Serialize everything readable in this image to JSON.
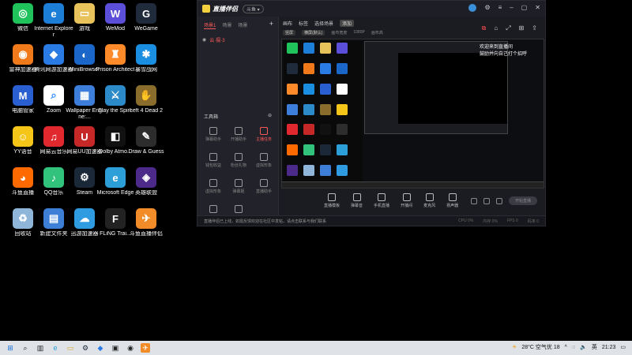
{
  "desktop": {
    "icons": [
      {
        "label": "微信",
        "icon": "wechat-icon",
        "color": "#20c35b",
        "glyph": "◎",
        "col": 0,
        "row": 0
      },
      {
        "label": "Internet Explorer",
        "icon": "ie-icon",
        "color": "#1c7ed6",
        "glyph": "e",
        "col": 1,
        "row": 0
      },
      {
        "label": "游戏",
        "icon": "folder-icon",
        "color": "#e8c25a",
        "glyph": "▭",
        "col": 2,
        "row": 0
      },
      {
        "label": "WeMod",
        "icon": "wemod-icon",
        "color": "#5b4fd9",
        "glyph": "W",
        "col": 3,
        "row": 0
      },
      {
        "label": "WeGame",
        "icon": "wegame-icon",
        "color": "#1f2b3a",
        "glyph": "G",
        "col": 4,
        "row": 0
      },
      {
        "label": "雷神加速器",
        "icon": "leishen-icon",
        "color": "#f07a1a",
        "glyph": "◉",
        "col": 0,
        "row": 1
      },
      {
        "label": "腾讯网游加速器",
        "icon": "tencent-acc-icon",
        "color": "#2a7be4",
        "glyph": "◆",
        "col": 1,
        "row": 1
      },
      {
        "label": "MiniBrowser",
        "icon": "minibrowser-icon",
        "color": "#1a66c9",
        "glyph": "◐",
        "col": 2,
        "row": 1
      },
      {
        "label": "Prison Architect",
        "icon": "prison-architect-icon",
        "color": "#ff8a2a",
        "glyph": "♜",
        "col": 3,
        "row": 1
      },
      {
        "label": "暴雪战网",
        "icon": "battlenet-icon",
        "color": "#1a8ee0",
        "glyph": "✱",
        "col": 4,
        "row": 1
      },
      {
        "label": "电脑管家",
        "icon": "pc-manager-icon",
        "color": "#2a5fd1",
        "glyph": "M",
        "col": 0,
        "row": 2
      },
      {
        "label": "Zoom",
        "icon": "zoom-icon",
        "color": "#ffffff",
        "glyph": "⌕",
        "col": 1,
        "row": 2
      },
      {
        "label": "Wallpaper Engine:...",
        "icon": "wallpaper-engine-icon",
        "color": "#3d7edb",
        "glyph": "▦",
        "col": 2,
        "row": 2
      },
      {
        "label": "Slay the Spire",
        "icon": "slay-the-spire-icon",
        "color": "#2c8ac9",
        "glyph": "⚔",
        "col": 3,
        "row": 2
      },
      {
        "label": "Left 4 Dead 2",
        "icon": "left4dead2-icon",
        "color": "#8a6d2c",
        "glyph": "✋",
        "col": 4,
        "row": 2
      },
      {
        "label": "YY语音",
        "icon": "yy-icon",
        "color": "#f5c518",
        "glyph": "☺",
        "col": 0,
        "row": 3
      },
      {
        "label": "网易云音乐",
        "icon": "netease-music-icon",
        "color": "#e0282e",
        "glyph": "♫",
        "col": 1,
        "row": 3
      },
      {
        "label": "网易UU加速器",
        "icon": "uu-icon",
        "color": "#c62828",
        "glyph": "U",
        "col": 2,
        "row": 3
      },
      {
        "label": "Dolby Atmo...",
        "icon": "dolby-icon",
        "color": "#111111",
        "glyph": "◧",
        "col": 3,
        "row": 3
      },
      {
        "label": "Draw & Guess",
        "icon": "draw-guess-icon",
        "color": "#2d2d2d",
        "glyph": "✎",
        "col": 4,
        "row": 3
      },
      {
        "label": "斗鱼直播",
        "icon": "douyu-icon",
        "color": "#ff6a00",
        "glyph": "◕",
        "col": 0,
        "row": 4
      },
      {
        "label": "QQ音乐",
        "icon": "qqmusic-icon",
        "color": "#31c27c",
        "glyph": "♪",
        "col": 1,
        "row": 4
      },
      {
        "label": "Steam",
        "icon": "steam-icon",
        "color": "#1b2838",
        "glyph": "⚙",
        "col": 2,
        "row": 4
      },
      {
        "label": "Microsoft Edge",
        "icon": "edge-icon",
        "color": "#2c9fd8",
        "glyph": "e",
        "col": 3,
        "row": 4
      },
      {
        "label": "英雄联盟",
        "icon": "lol-icon",
        "color": "#4b2a8a",
        "glyph": "◈",
        "col": 4,
        "row": 4
      },
      {
        "label": "回收站",
        "icon": "recycle-bin-icon",
        "color": "#8fb6d9",
        "glyph": "♻",
        "col": 0,
        "row": 5
      },
      {
        "label": "新建文件夹",
        "icon": "new-folder-icon",
        "color": "#3d7fd6",
        "glyph": "▤",
        "col": 1,
        "row": 5
      },
      {
        "label": "迅游加速器",
        "icon": "xunyou-icon",
        "color": "#2f9be0",
        "glyph": "☁",
        "col": 2,
        "row": 5
      },
      {
        "label": "FLiNG Trai...",
        "icon": "fling-trainer-icon",
        "color": "#222222",
        "glyph": "F",
        "col": 3,
        "row": 5
      },
      {
        "label": "斗鱼直播伴侣",
        "icon": "douyu-companion-icon",
        "color": "#f28c28",
        "glyph": "✈",
        "col": 4,
        "row": 5
      }
    ]
  },
  "app": {
    "title": "直播伴侣",
    "version": "斗鱼 ▾",
    "left_tabs": [
      "场景1",
      "场景",
      "场景"
    ],
    "scene_item": "云·摄·3",
    "toolbox_label": "工具箱",
    "tools": [
      {
        "label": "弹幕助手",
        "red": false
      },
      {
        "label": "开播助手",
        "red": false
      },
      {
        "label": "主播任务",
        "red": true
      },
      {
        "label": "钱包收益",
        "red": false
      },
      {
        "label": "粉丝礼物",
        "red": false
      },
      {
        "label": "虚拟形象",
        "red": false
      },
      {
        "label": "虚拟形象",
        "red": false
      },
      {
        "label": "弹幕姬",
        "red": false
      },
      {
        "label": "直播助手",
        "red": false
      },
      {
        "label": "",
        "red": false
      },
      {
        "label": "",
        "red": false
      }
    ],
    "preview_tabs": [
      "画布",
      "标签",
      "选择场景",
      "添加"
    ],
    "preview_sub": [
      "竖屏",
      "横屏(默认)",
      "画布宽度",
      "1080P",
      "画布高"
    ],
    "preview_text_lines": [
      "欢迎来到直播间",
      "鼓励并向自己打个招呼"
    ],
    "actions": [
      "直播模板",
      "弹幕音",
      "手机直播",
      "开播间",
      "麦克风",
      "扬声器"
    ],
    "start_live": "开始直播",
    "status_text": "直播伴侣已上线，如需反馈欢迎在社区中发帖，请点击联系与我们联系",
    "status_stats": [
      "CPU 0%",
      "内存 0%",
      "FPS 0",
      "码率 0"
    ]
  },
  "taskbar": {
    "weather": "28°C 空气优 18",
    "lang": "英",
    "time": "21:23"
  }
}
